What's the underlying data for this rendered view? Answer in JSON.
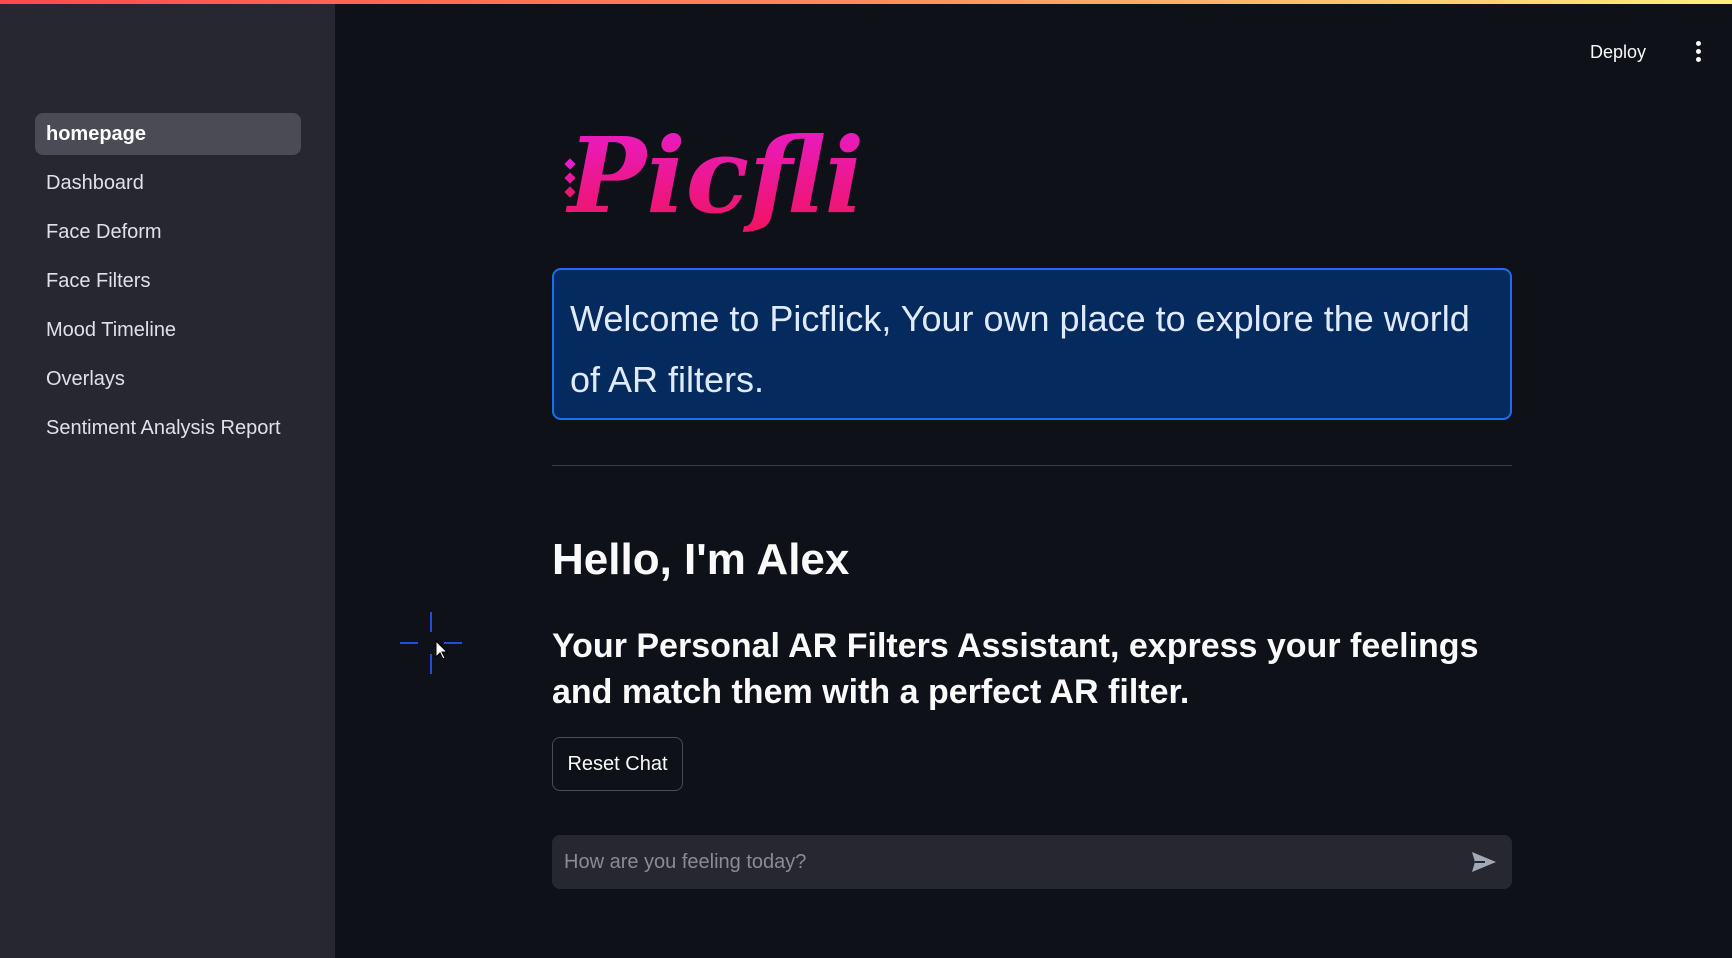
{
  "sidebar": {
    "items": [
      {
        "label": "homepage",
        "active": true
      },
      {
        "label": "Dashboard",
        "active": false
      },
      {
        "label": "Face Deform",
        "active": false
      },
      {
        "label": "Face Filters",
        "active": false
      },
      {
        "label": "Mood Timeline",
        "active": false
      },
      {
        "label": "Overlays",
        "active": false
      },
      {
        "label": "Sentiment Analysis Report",
        "active": false
      }
    ]
  },
  "toolbar": {
    "deploy_label": "Deploy",
    "menu_icon": "kebab-menu-icon"
  },
  "main": {
    "logo_text": "Picflick",
    "welcome_text": "Welcome to Picflick, Your own place to explore the world of AR filters.",
    "hello_heading": "Hello, I'm Alex",
    "subheading": "Your Personal AR Filters Assistant, express your feelings and match them with a perfect AR filter.",
    "reset_label": "Reset Chat",
    "chat": {
      "placeholder": "How are you feeling today?",
      "value": "",
      "send_icon": "send-icon"
    }
  },
  "colors": {
    "background": "#0e1117",
    "sidebar": "#262730",
    "info_box": "#052a5e",
    "info_border": "#1f6cf0",
    "logo_top": "#e81ccf",
    "logo_bottom": "#f0145a"
  }
}
